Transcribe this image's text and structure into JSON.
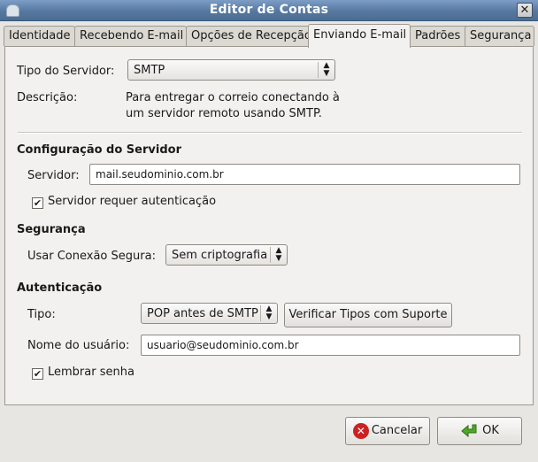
{
  "window": {
    "title": "Editor de Contas",
    "close_glyph": "✕"
  },
  "tabs": [
    {
      "label": "Identidade"
    },
    {
      "label": "Recebendo E-mail"
    },
    {
      "label": "Opções de Recepção"
    },
    {
      "label": "Enviando E-mail"
    },
    {
      "label": "Padrões"
    },
    {
      "label": "Segurança"
    }
  ],
  "server_type": {
    "label": "Tipo do Servidor:",
    "value": "SMTP",
    "description_label": "Descrição:",
    "description_line1": "Para entregar o correio conectando à",
    "description_line2": "um servidor remoto usando SMTP."
  },
  "server_config": {
    "heading": "Configuração do Servidor",
    "server_label": "Servidor:",
    "server_value": "mail.seudominio.com.br",
    "auth_required_label": "Servidor requer autenticação",
    "auth_required_checked": true
  },
  "security": {
    "heading": "Segurança",
    "secure_label": "Usar Conexão Segura:",
    "secure_value": "Sem criptografia"
  },
  "authentication": {
    "heading": "Autenticação",
    "type_label": "Tipo:",
    "type_value": "POP antes de SMTP",
    "check_types_button": "Verificar Tipos com Suporte",
    "username_label": "Nome do usuário:",
    "username_value": "usuario@seudominio.com.br",
    "remember_label": "Lembrar senha",
    "remember_checked": true
  },
  "footer": {
    "cancel_label": "Cancelar",
    "ok_label": "OK"
  },
  "icons": {
    "cancel": "cancel-icon",
    "ok": "green-arrow-icon",
    "checkmark": "✔",
    "combo_arrow": "▲▼"
  }
}
